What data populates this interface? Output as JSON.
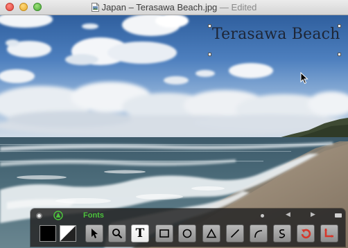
{
  "window": {
    "title": "Japan – Terasawa Beach.jpg",
    "separator": "—",
    "status": "Edited"
  },
  "icons": {
    "document": "jpg-document-icon",
    "cursor": "arrow-cursor-icon"
  },
  "photo": {
    "annotation_text": "Terasawa Beach",
    "annotation_color": "#1e2636"
  },
  "toolbar": {
    "fonts_label": "Fonts",
    "fonts_color": "#4cc23c",
    "stroke_color": "#000000",
    "fill_color": "none",
    "text_tool_label": "T",
    "tools": [
      {
        "name": "select-arrow",
        "selected": false
      },
      {
        "name": "zoom",
        "selected": false
      },
      {
        "name": "text",
        "selected": true
      },
      {
        "name": "rectangle",
        "selected": false
      },
      {
        "name": "oval",
        "selected": false
      },
      {
        "name": "triangle",
        "selected": false
      },
      {
        "name": "line",
        "selected": false
      },
      {
        "name": "curve",
        "selected": false
      },
      {
        "name": "freehand",
        "selected": false
      },
      {
        "name": "rotate",
        "selected": false
      },
      {
        "name": "crop",
        "selected": false
      }
    ],
    "nav": {
      "prev_label": "◀",
      "next_label": "▶"
    }
  }
}
